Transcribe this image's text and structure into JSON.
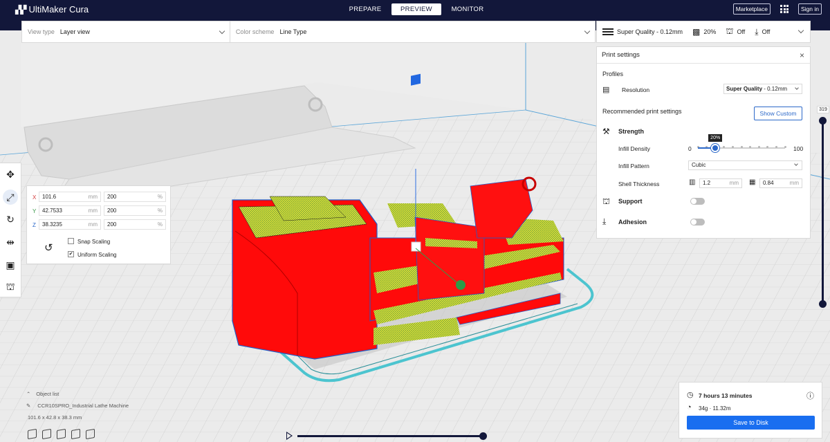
{
  "app": {
    "name": "UltiMaker Cura"
  },
  "stages": [
    {
      "label": "PREPARE",
      "active": false
    },
    {
      "label": "PREVIEW",
      "active": true
    },
    {
      "label": "MONITOR",
      "active": false
    }
  ],
  "topbar": {
    "marketplace": "Marketplace",
    "signin": "Sign in"
  },
  "viewbar": {
    "view_type_label": "View type",
    "view_type_value": "Layer view",
    "color_scheme_label": "Color scheme",
    "color_scheme_value": "Line Type"
  },
  "printbar": {
    "quality": "Super Quality - 0.12mm",
    "infill": "20%",
    "support": "Off",
    "adhesion": "Off"
  },
  "print_settings": {
    "title": "Print settings",
    "profiles": "Profiles",
    "resolution_label": "Resolution",
    "resolution_bold": "Super Quality",
    "resolution_rest": " - 0.12mm",
    "recommended": "Recommended print settings",
    "show_custom": "Show Custom",
    "strength": "Strength",
    "infill_density_label": "Infill Density",
    "infill_min": "0",
    "infill_max": "100",
    "infill_value": "20%",
    "infill_fraction": 0.2,
    "infill_pattern_label": "Infill Pattern",
    "infill_pattern_value": "Cubic",
    "shell_thickness_label": "Shell Thickness",
    "wall_thickness": "1.2",
    "top_bottom_thickness": "0.84",
    "unit_mm": "mm",
    "support": "Support",
    "adhesion": "Adhesion"
  },
  "scale": {
    "x_axis": "X",
    "y_axis": "Y",
    "z_axis": "Z",
    "x_mm": "101.6",
    "y_mm": "42.7533",
    "z_mm": "38.3235",
    "x_pct": "200",
    "y_pct": "200",
    "z_pct": "200",
    "unit_mm": "mm",
    "unit_pct": "%",
    "snap_scaling": "Snap Scaling",
    "uniform_scaling": "Uniform Scaling",
    "snap_checked": false,
    "uniform_checked": true
  },
  "object_list": {
    "header": "Object list",
    "item": "CCR10SPRO_Industrial Lathe Machine",
    "dimensions": "101.6 x 42.8 x 38.3 mm"
  },
  "layer_slider": {
    "value": "319"
  },
  "estimate": {
    "time": "7 hours 13 minutes",
    "material": "34g · 11.32m",
    "save": "Save to Disk"
  },
  "colors": {
    "brand_dark": "#12173a",
    "accent_blue": "#196ef0",
    "model_red": "#ff0000",
    "infill_yellow": "#e8e83a",
    "skirt_cyan": "#52c6d0"
  }
}
